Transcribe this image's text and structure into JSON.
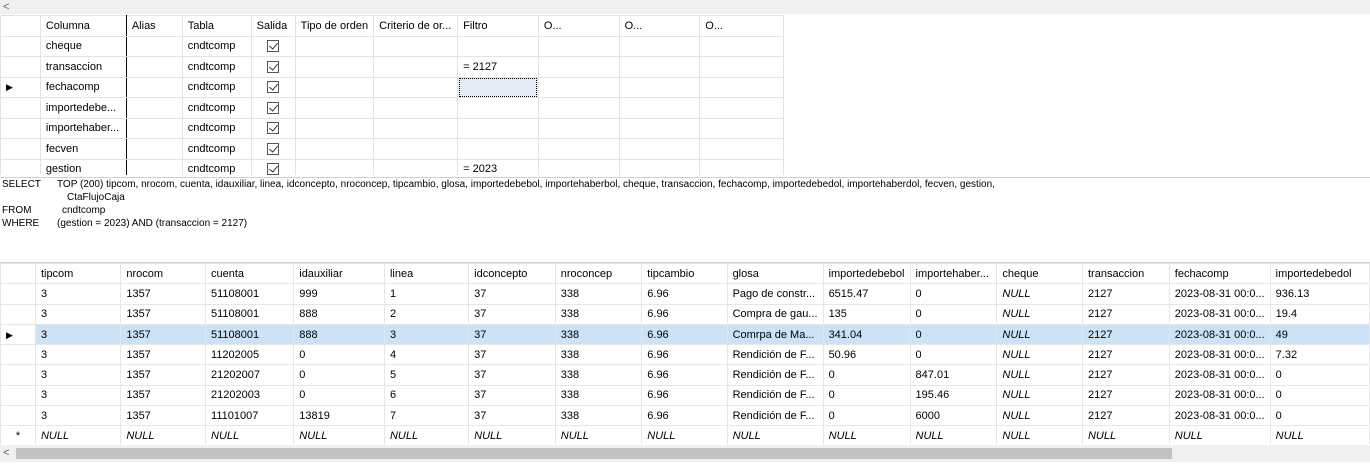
{
  "scroll_left_glyph": "<",
  "criteria": {
    "columns": [
      "Columna",
      "Alias",
      "Tabla",
      "Salida",
      "Tipo de orden",
      "Criterio de or...",
      "Filtro",
      "O...",
      "O...",
      "O..."
    ],
    "rows": [
      {
        "columna": "cheque",
        "tabla": "cndtcomp",
        "filtro": ""
      },
      {
        "columna": "transaccion",
        "tabla": "cndtcomp",
        "filtro": "= 2127"
      },
      {
        "columna": "fechacomp",
        "tabla": "cndtcomp",
        "filtro": ""
      },
      {
        "columna": "importedebe...",
        "tabla": "cndtcomp",
        "filtro": ""
      },
      {
        "columna": "importehaber...",
        "tabla": "cndtcomp",
        "filtro": ""
      },
      {
        "columna": "fecven",
        "tabla": "cndtcomp",
        "filtro": ""
      },
      {
        "columna": "gestion",
        "tabla": "cndtcomp",
        "filtro": "= 2023"
      }
    ],
    "current_row_marker": "▶"
  },
  "sql": {
    "select_kw": "SELECT",
    "select_line1": "TOP (200) tipcom, nrocom, cuenta, idauxiliar, linea, idconcepto, nroconcep, tipcambio, glosa, importedebebol, importehaberbol, cheque, transaccion, fechacomp, importedebedol, importehaberdol, fecven, gestion,",
    "select_line2": "CtaFlujoCaja",
    "from_kw": "FROM",
    "from_val": "cndtcomp",
    "where_kw": "WHERE",
    "where_val": "(gestion = 2023) AND (transaccion = 2127)"
  },
  "results": {
    "columns": [
      "tipcom",
      "nrocom",
      "cuenta",
      "idauxiliar",
      "linea",
      "idconcepto",
      "nroconcep",
      "tipcambio",
      "glosa",
      "importedebebol",
      "importehaber...",
      "cheque",
      "transaccion",
      "fechacomp",
      "importedebedol"
    ],
    "rows": [
      [
        "3",
        "1357",
        "51108001",
        "999",
        "1",
        "37",
        "338",
        "6.96",
        "Pago de constr...",
        "6515.47",
        "0",
        "NULL",
        "2127",
        "2023-08-31 00:0...",
        "936.13"
      ],
      [
        "3",
        "1357",
        "51108001",
        "888",
        "2",
        "37",
        "338",
        "6.96",
        "Compra de gau...",
        "135",
        "0",
        "NULL",
        "2127",
        "2023-08-31 00:0...",
        "19.4"
      ],
      [
        "3",
        "1357",
        "51108001",
        "888",
        "3",
        "37",
        "338",
        "6.96",
        "Comrpa de Ma...",
        "341.04",
        "0",
        "NULL",
        "2127",
        "2023-08-31 00:0...",
        "49"
      ],
      [
        "3",
        "1357",
        "11202005",
        "0",
        "4",
        "37",
        "338",
        "6.96",
        "Rendición de F...",
        "50.96",
        "0",
        "NULL",
        "2127",
        "2023-08-31 00:0...",
        "7.32"
      ],
      [
        "3",
        "1357",
        "21202007",
        "0",
        "5",
        "37",
        "338",
        "6.96",
        "Rendición de F...",
        "0",
        "847.01",
        "NULL",
        "2127",
        "2023-08-31 00:0...",
        "0"
      ],
      [
        "3",
        "1357",
        "21202003",
        "0",
        "6",
        "37",
        "338",
        "6.96",
        "Rendición de F...",
        "0",
        "195.46",
        "NULL",
        "2127",
        "2023-08-31 00:0...",
        "0"
      ],
      [
        "3",
        "1357",
        "11101007",
        "13819",
        "7",
        "37",
        "338",
        "6.96",
        "Rendición de F...",
        "0",
        "6000",
        "NULL",
        "2127",
        "2023-08-31 00:0...",
        "0"
      ]
    ],
    "new_row": [
      "NULL",
      "NULL",
      "NULL",
      "NULL",
      "NULL",
      "NULL",
      "NULL",
      "NULL",
      "NULL",
      "NULL",
      "NULL",
      "NULL",
      "NULL",
      "NULL",
      "NULL"
    ],
    "new_row_marker": "*",
    "current_row_marker": "▶",
    "selected_row_index": 2,
    "selected_color": "#cce3f7"
  }
}
